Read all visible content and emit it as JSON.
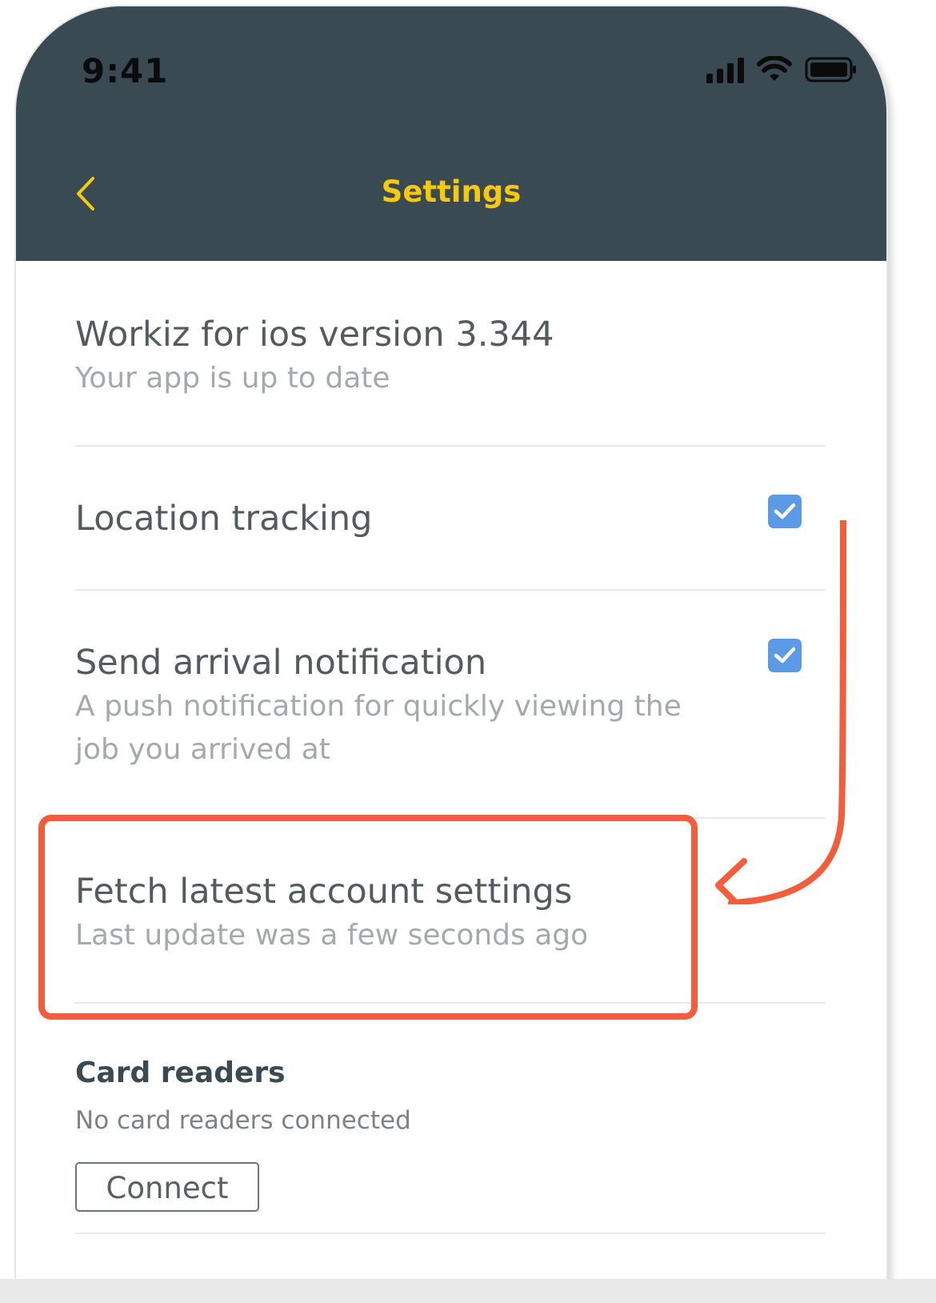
{
  "status_bar": {
    "time": "9:41",
    "icons": [
      "signal-icon",
      "wifi-icon",
      "battery-icon"
    ]
  },
  "nav": {
    "back_icon": "chevron-left-icon",
    "title": "Settings"
  },
  "settings": {
    "version": {
      "title": "Workiz for ios version 3.344",
      "subtitle": "Your app is up to date"
    },
    "location_tracking": {
      "title": "Location tracking",
      "checked": true
    },
    "arrival_notification": {
      "title": "Send arrival notification",
      "subtitle_line1": "A push notification for quickly viewing the",
      "subtitle_line2": "job you arrived at",
      "checked": true
    },
    "fetch_settings": {
      "title": "Fetch latest account settings",
      "subtitle": "Last update was a few seconds ago"
    }
  },
  "card_readers": {
    "title": "Card readers",
    "status": "No card readers connected",
    "connect_label": "Connect"
  },
  "colors": {
    "header_bg": "#3a4a53",
    "accent_yellow": "#f6c90e",
    "checkbox_blue": "#5b9be6",
    "annotation_red": "#f25d3c"
  }
}
